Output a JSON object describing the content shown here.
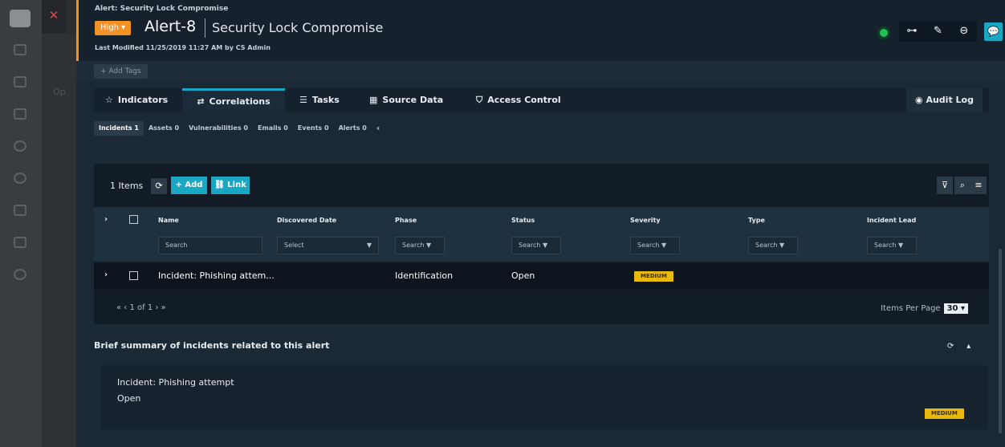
{
  "header": {
    "breadcrumb": "Alert: Security Lock Compromise",
    "severity": "High ▾",
    "alert_id": "Alert-8",
    "alert_title": "Security Lock Compromise",
    "last_modified": "Last Modified 11/25/2019 11:27 AM by CS Admin"
  },
  "background": {
    "label": "Op"
  },
  "tags": {
    "add_label": "+ Add Tags"
  },
  "tabs": [
    {
      "label": "Indicators",
      "icon": "star-icon"
    },
    {
      "label": "Correlations",
      "icon": "arrows-icon"
    },
    {
      "label": "Tasks",
      "icon": "list-icon"
    },
    {
      "label": "Source Data",
      "icon": "table-icon"
    },
    {
      "label": "Access Control",
      "icon": "shield-icon"
    }
  ],
  "audit_label": "Audit Log",
  "subtabs": [
    {
      "label": "Incidents",
      "count": "1"
    },
    {
      "label": "Assets",
      "count": "0"
    },
    {
      "label": "Vulnerabilities",
      "count": "0"
    },
    {
      "label": "Emails",
      "count": "0"
    },
    {
      "label": "Events",
      "count": "0"
    },
    {
      "label": "Alerts",
      "count": "0"
    }
  ],
  "grid": {
    "item_count": "1 Items",
    "add_label": "+ Add",
    "link_label": "Link",
    "columns": [
      "Name",
      "Discovered Date",
      "Phase",
      "Status",
      "Severity",
      "Type",
      "Incident Lead"
    ],
    "filters": [
      "Search",
      "Select",
      "Search",
      "Search",
      "Search",
      "Search",
      "Search"
    ],
    "row": {
      "name": "Incident: Phishing attem...",
      "discovered_date": "",
      "phase": "Identification",
      "status": "Open",
      "severity": "MEDIUM",
      "type": "",
      "incident_lead": ""
    },
    "pager": "«  ‹   1 of 1   ›  »",
    "items_per_page_label": "Items Per Page",
    "items_per_page_value": "30 ▾"
  },
  "summary": {
    "title": "Brief summary of incidents related to this alert",
    "incident_name": "Incident: Phishing attempt",
    "incident_status": "Open",
    "incident_severity": "MEDIUM"
  }
}
